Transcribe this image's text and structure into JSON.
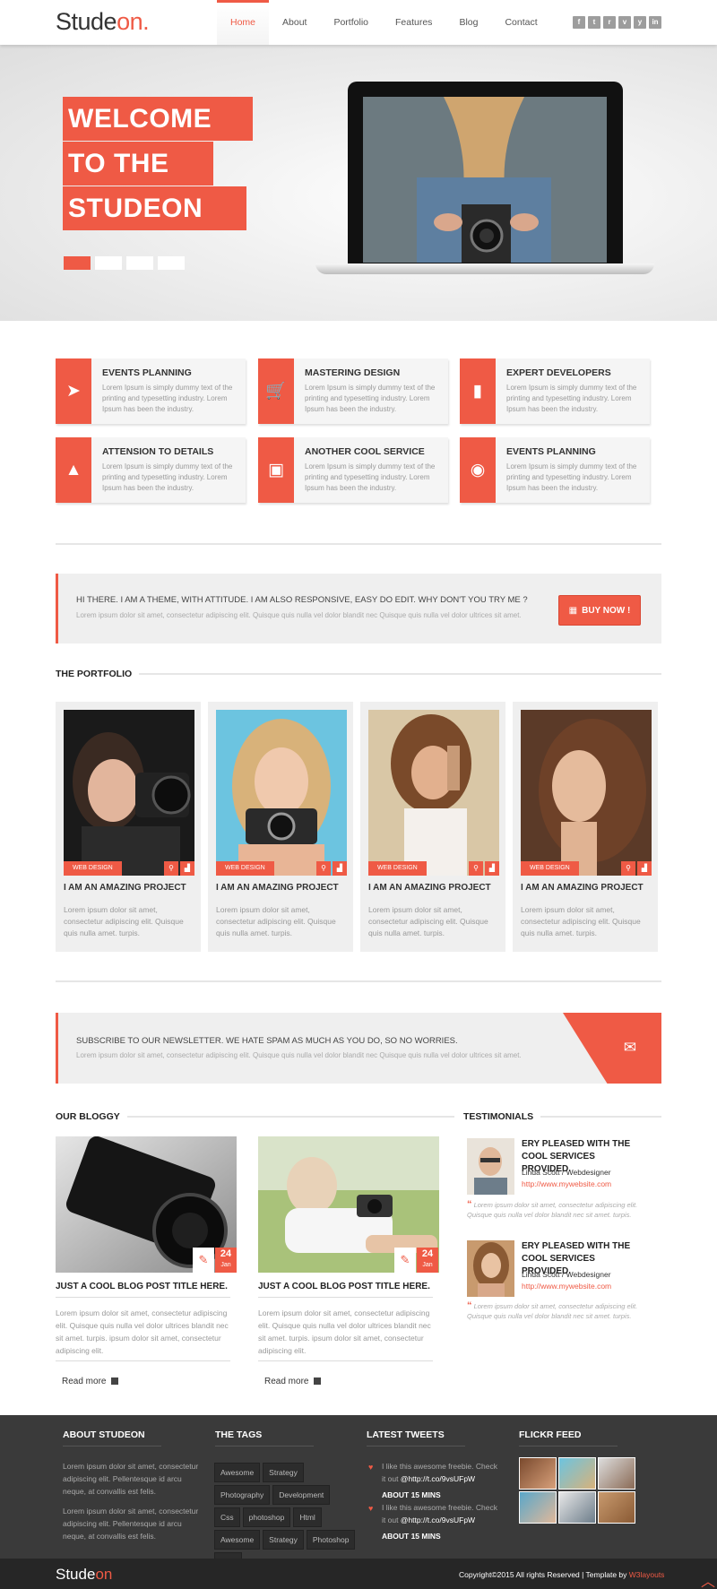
{
  "brand": {
    "logo_main": "Stude",
    "logo_accent": "on",
    "logo_dot": "."
  },
  "colors": {
    "accent": "#ef5a45",
    "footer_bg": "#3a3a3a",
    "panel_bg": "#efefef"
  },
  "nav": {
    "items": [
      {
        "label": "Home",
        "active": true
      },
      {
        "label": "About"
      },
      {
        "label": "Portfolio"
      },
      {
        "label": "Features"
      },
      {
        "label": "Blog"
      },
      {
        "label": "Contact"
      }
    ]
  },
  "social": [
    "f",
    "t",
    "r",
    "v",
    "y",
    "in"
  ],
  "hero": {
    "line1": "WELCOME",
    "line2": "TO THE",
    "line3": "STUDEON",
    "slides": 4,
    "active_slide": 1
  },
  "features": [
    {
      "title": "EVENTS PLANNING",
      "icon": "paper-plane-icon",
      "glyph": "➤",
      "desc": "Lorem Ipsum is simply dummy text of the printing and typesetting industry. Lorem Ipsum has been the industry."
    },
    {
      "title": "MASTERING DESIGN",
      "icon": "shopping-cart-icon",
      "glyph": "🛒",
      "desc": "Lorem Ipsum is simply dummy text of the printing and typesetting industry. Lorem Ipsum has been the industry."
    },
    {
      "title": "EXPERT DEVELOPERS",
      "icon": "book-icon",
      "glyph": "▮",
      "desc": "Lorem Ipsum is simply dummy text of the printing and typesetting industry. Lorem Ipsum has been the industry."
    },
    {
      "title": "ATTENSION TO DETAILS",
      "icon": "traffic-cone-icon",
      "glyph": "▲",
      "desc": "Lorem Ipsum is simply dummy text of the printing and typesetting industry. Lorem Ipsum has been the industry."
    },
    {
      "title": "ANOTHER COOL SERVICE",
      "icon": "briefcase-icon",
      "glyph": "▣",
      "desc": "Lorem Ipsum is simply dummy text of the printing and typesetting industry. Lorem Ipsum has been the industry."
    },
    {
      "title": "EVENTS PLANNING",
      "icon": "camera-icon",
      "glyph": "◉",
      "desc": "Lorem Ipsum is simply dummy text of the printing and typesetting industry. Lorem Ipsum has been the industry."
    }
  ],
  "callout": {
    "title": "HI THERE. I AM A THEME, WITH ATTITUDE. I AM ALSO RESPONSIVE, EASY DO EDIT. WHY DON'T YOU TRY ME ?",
    "subtitle": "Lorem ipsum dolor sit amet, consectetur adipiscing elit. Quisque quis nulla vel dolor blandit nec Quisque quis nulla vel dolor ultrices sit amet.",
    "button_label": "BUY NOW !"
  },
  "portfolio": {
    "heading": "THE PORTFOLIO",
    "items": [
      {
        "tag": "WEB DESIGN",
        "title": "I AM AN AMAZING PROJECT",
        "desc": "Lorem ipsum dolor sit amet, consectetur adipiscing elit. Quisque quis nulla amet. turpis."
      },
      {
        "tag": "WEB DESIGN",
        "title": "I AM AN AMAZING PROJECT",
        "desc": "Lorem ipsum dolor sit amet, consectetur adipiscing elit. Quisque quis nulla amet. turpis."
      },
      {
        "tag": "WEB DESIGN",
        "title": "I AM AN AMAZING PROJECT",
        "desc": "Lorem ipsum dolor sit amet, consectetur adipiscing elit. Quisque quis nulla amet. turpis."
      },
      {
        "tag": "WEB DESIGN",
        "title": "I AM AN AMAZING PROJECT",
        "desc": "Lorem ipsum dolor sit amet, consectetur adipiscing elit. Quisque quis nulla amet. turpis."
      }
    ]
  },
  "newsletter": {
    "title": "SUBSCRIBE TO OUR NEWSLETTER. WE HATE SPAM AS MUCH AS YOU DO, SO NO WORRIES.",
    "subtitle": "Lorem ipsum dolor sit amet, consectetur adipiscing elit. Quisque quis nulla vel dolor blandit nec Quisque quis nulla vel dolor ultrices sit amet."
  },
  "blog": {
    "heading": "OUR BLOGGY",
    "posts": [
      {
        "day": "24",
        "month": "Jan",
        "title": "JUST A COOL BLOG POST TITLE HERE.",
        "desc": "Lorem ipsum dolor sit amet, consectetur adipiscing elit. Quisque quis nulla vel dolor ultrices blandit nec sit amet. turpis. ipsum dolor sit amet, consectetur adipiscing elit.",
        "more": "Read more"
      },
      {
        "day": "24",
        "month": "Jan",
        "title": "JUST A COOL BLOG POST TITLE HERE.",
        "desc": "Lorem ipsum dolor sit amet, consectetur adipiscing elit. Quisque quis nulla vel dolor ultrices blandit nec sit amet. turpis. ipsum dolor sit amet, consectetur adipiscing elit.",
        "more": "Read more"
      }
    ]
  },
  "testimonials": {
    "heading": "TESTIMONIALS",
    "items": [
      {
        "headline": "ERY PLEASED WITH THE COOL SERVICES PROVIDED.",
        "name": "Linda Scott / Webdesigner",
        "link": "http://www.mywebsite.com",
        "quote": "Lorem ipsum dolor sit amet, consectetur adipiscing elit. Quisque quis nulla vel dolor blandit nec sit amet. turpis."
      },
      {
        "headline": "ERY PLEASED WITH THE COOL SERVICES PROVIDED.",
        "name": "Linda Scott / Webdesigner",
        "link": "http://www.mywebsite.com",
        "quote": "Lorem ipsum dolor sit amet, consectetur adipiscing elit. Quisque quis nulla vel dolor blandit nec sit amet. turpis."
      }
    ]
  },
  "footer": {
    "about": {
      "heading": "ABOUT STUDEON",
      "p1": "Lorem ipsum dolor sit amet, consectetur adipiscing elit. Pellentesque id arcu neque, at convallis est felis.",
      "p2": "Lorem ipsum dolor sit amet, consectetur adipiscing elit. Pellentesque id arcu neque, at convallis est felis."
    },
    "tags": {
      "heading": "THE TAGS",
      "items": [
        "Awesome",
        "Strategy",
        "Photography",
        "Development",
        "Css",
        "photoshop",
        "Html",
        "Awesome",
        "Strategy",
        "Photoshop",
        "Html"
      ]
    },
    "tweets": {
      "heading": "LATEST TWEETS",
      "items": [
        {
          "text": "I like this awesome freebie. Check it out",
          "link": "@http://t.co/9vsUFpW",
          "when": "ABOUT 15 MINS"
        },
        {
          "text": "I like this awesome freebie. Check it out",
          "link": "@http://t.co/9vsUFpW",
          "when": "ABOUT 15 MINS"
        }
      ]
    },
    "flickr": {
      "heading": "FLICKR FEED",
      "count": 6
    },
    "bottom": {
      "logo_main": "Stude",
      "logo_accent": "on",
      "copyright": "Copyright©2015 All rights Reserved | Template by ",
      "credit": "W3layouts"
    }
  }
}
